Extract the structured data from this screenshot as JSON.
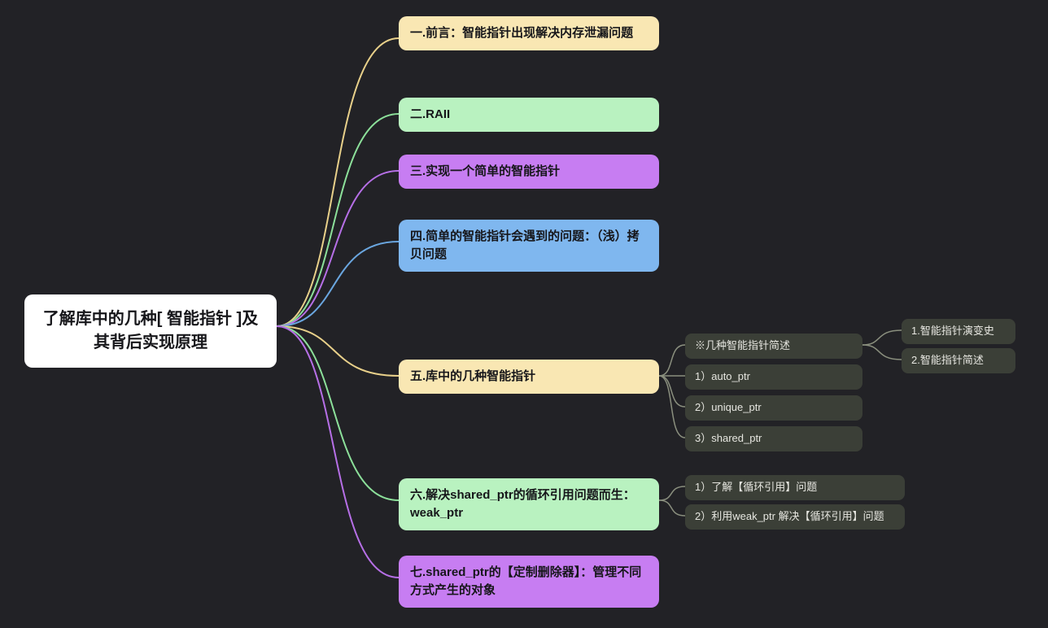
{
  "root": {
    "title": "了解库中的几种[ 智能指针 ]及其背后实现原理"
  },
  "branches": [
    {
      "label": "一.前言：智能指针出现解决内存泄漏问题",
      "color": "beige"
    },
    {
      "label": "二.RAII",
      "color": "green"
    },
    {
      "label": "三.实现一个简单的智能指针",
      "color": "purple"
    },
    {
      "label": "四.简单的智能指针会遇到的问题：（浅）拷贝问题",
      "color": "blue"
    },
    {
      "label": "五.库中的几种智能指针",
      "color": "beige",
      "children": [
        {
          "label": "※几种智能指针简述",
          "children": [
            {
              "label": "1.智能指针演变史"
            },
            {
              "label": "2.智能指针简述"
            }
          ]
        },
        {
          "label": "1）auto_ptr"
        },
        {
          "label": "2）unique_ptr"
        },
        {
          "label": "3）shared_ptr"
        }
      ]
    },
    {
      "label": "六.解决shared_ptr的循环引用问题而生：weak_ptr",
      "color": "green",
      "children": [
        {
          "label": "1）了解【循环引用】问题"
        },
        {
          "label": "2）利用weak_ptr 解决【循环引用】问题"
        }
      ]
    },
    {
      "label": "七.shared_ptr的【定制删除器】：管理不同方式产生的对象",
      "color": "purple"
    }
  ]
}
